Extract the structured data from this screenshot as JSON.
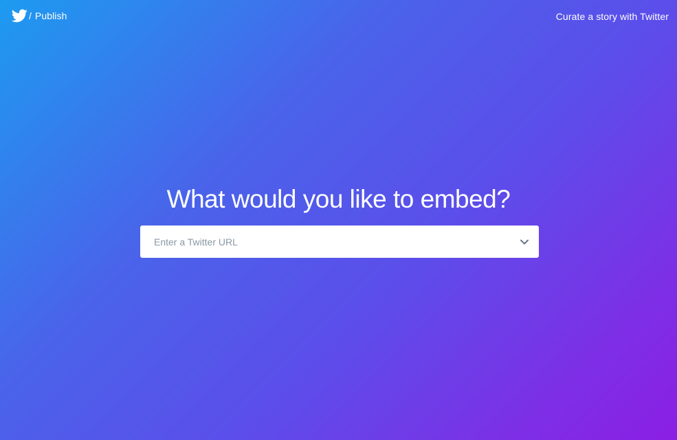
{
  "header": {
    "brand_icon": "twitter-bird-icon",
    "separator": "/",
    "brand_label": "Publish",
    "curate_link": "Curate a story with Twitter"
  },
  "hero": {
    "title": "What would you like to embed?"
  },
  "url_input": {
    "placeholder": "Enter a Twitter URL",
    "value": "",
    "dropdown_icon": "chevron-down-icon"
  },
  "colors": {
    "gradient_start": "#1d9bf0",
    "gradient_end": "#8b1fe3",
    "text": "#ffffff",
    "placeholder": "#8899a6",
    "input_bg": "#ffffff"
  }
}
